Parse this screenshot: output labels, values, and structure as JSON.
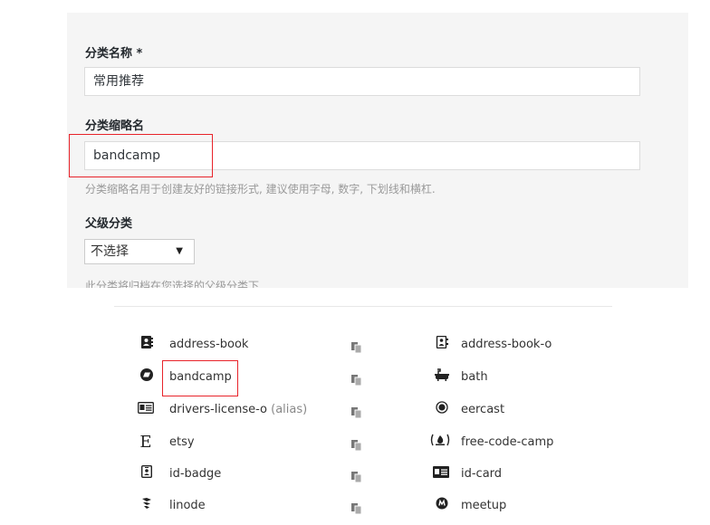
{
  "form": {
    "name_label": "分类名称 *",
    "name_value": "常用推荐",
    "slug_label": "分类缩略名",
    "slug_value": "bandcamp",
    "slug_hint": "分类缩略名用于创建友好的链接形式, 建议使用字母, 数字, 下划线和横杠.",
    "parent_label": "父级分类",
    "parent_selected": "不选择",
    "parent_hint": "此分类将归档在您选择的父级分类下"
  },
  "icons": {
    "rows": [
      {
        "left": {
          "name": "address-book",
          "icon": "address-book-icon"
        },
        "right": {
          "name": "address-book-o",
          "icon": "address-book-o-icon"
        }
      },
      {
        "left": {
          "name": "bandcamp",
          "icon": "bandcamp-icon"
        },
        "right": {
          "name": "bath",
          "icon": "bath-icon"
        }
      },
      {
        "left": {
          "name": "drivers-license-o",
          "alias": "(alias)",
          "icon": "drivers-license-o-icon"
        },
        "right": {
          "name": "eercast",
          "icon": "eercast-icon"
        }
      },
      {
        "left": {
          "name": "etsy",
          "icon": "etsy-icon"
        },
        "right": {
          "name": "free-code-camp",
          "icon": "free-code-camp-icon"
        }
      },
      {
        "left": {
          "name": "id-badge",
          "icon": "id-badge-icon"
        },
        "right": {
          "name": "id-card",
          "icon": "id-card-icon"
        }
      },
      {
        "left": {
          "name": "linode",
          "icon": "linode-icon"
        },
        "right": {
          "name": "meetup",
          "icon": "meetup-icon"
        }
      }
    ],
    "copy_icon": "copy-icon"
  },
  "colors": {
    "highlight": "#e8232a",
    "panel_bg": "#f5f5f5"
  }
}
